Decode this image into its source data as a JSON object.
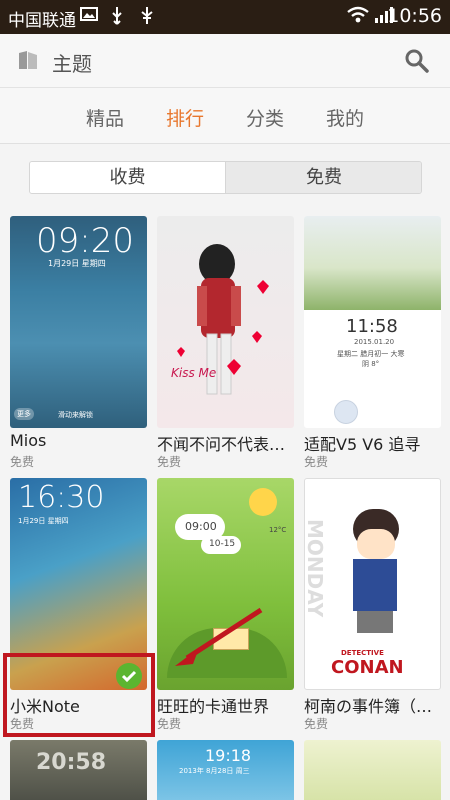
{
  "status_bar": {
    "carrier": "中国联通",
    "time": "10:56"
  },
  "header": {
    "title": "主题"
  },
  "tabs": [
    {
      "label": "精品",
      "active": false
    },
    {
      "label": "排行",
      "active": true
    },
    {
      "label": "分类",
      "active": false
    },
    {
      "label": "我的",
      "active": false
    }
  ],
  "segment": {
    "left": "收费",
    "right": "免费"
  },
  "themes": [
    {
      "name": "Mios",
      "price": "免费",
      "preview_time": "09:20",
      "preview_date": "1月29日 星期四",
      "preview_hint": "滑动来解锁",
      "preview_more": "更多"
    },
    {
      "name": "不闻不问不代表…",
      "price": "免费",
      "preview_caption": "Kiss Me"
    },
    {
      "name": "适配V5 V6 追寻",
      "price": "免费",
      "preview_time": "11:58",
      "preview_date": "2015.01.20",
      "preview_info": "星期二 腊月初一 大寒",
      "preview_temp": "阴 8°"
    },
    {
      "name": "小米Note",
      "price": "免费",
      "preview_time": "16:30",
      "preview_date": "1月29日 星期四"
    },
    {
      "name": "旺旺的卡通世界",
      "price": "免费",
      "preview_time": "09:00",
      "preview_date": "10-15",
      "preview_temp": "12°C"
    },
    {
      "name": "柯南の事件簿（…",
      "price": "免费",
      "preview_logo_top": "DETECTIVE",
      "preview_logo_main": "CONAN",
      "preview_side": "MONDAY"
    }
  ],
  "bottom_row": {
    "time_1": "20:58",
    "time_2": "19:18",
    "date_2": "2013年 8月28日 周三"
  },
  "colors": {
    "accent": "#e8772e",
    "status_bar": "#2a1e14",
    "highlight": "#c0171f",
    "check": "#5cb530"
  }
}
